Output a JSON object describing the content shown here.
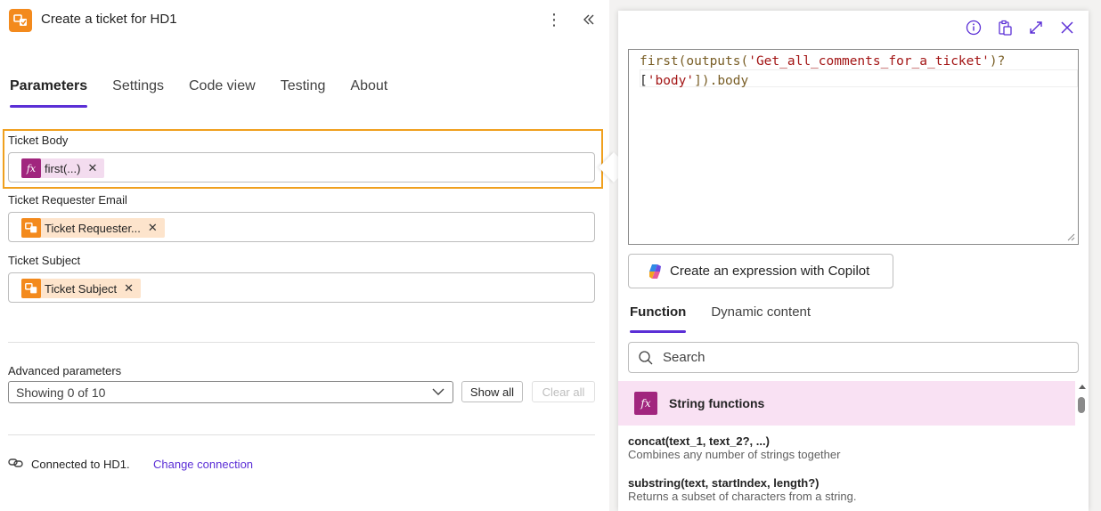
{
  "header": {
    "title": "Create a ticket for HD1",
    "more_label": "⋮"
  },
  "tabs": [
    {
      "label": "Parameters"
    },
    {
      "label": "Settings"
    },
    {
      "label": "Code view"
    },
    {
      "label": "Testing"
    },
    {
      "label": "About"
    }
  ],
  "fields": {
    "ticket_body": {
      "label": "Ticket Body",
      "token": "first(...)"
    },
    "ticket_requester_email": {
      "label": "Ticket Requester Email",
      "token": "Ticket Requester..."
    },
    "ticket_subject": {
      "label": "Ticket Subject",
      "token": "Ticket Subject"
    }
  },
  "token_remove": "✕",
  "advanced": {
    "label": "Advanced parameters",
    "selected": "Showing 0 of 10",
    "show_all": "Show all",
    "clear_all": "Clear all"
  },
  "connection": {
    "text": "Connected to HD1.",
    "change": "Change connection"
  },
  "expression": {
    "line1_fn": "first(outputs(",
    "line1_str": "'Get_all_comments_for_a_ticket'",
    "line1_end": ")?",
    "line2_open": "[",
    "line2_str": "'body'",
    "line2_end": "]).body"
  },
  "copilot_button": "Create an expression with Copilot",
  "right_tabs": [
    {
      "label": "Function"
    },
    {
      "label": "Dynamic content"
    }
  ],
  "search": {
    "placeholder": "Search"
  },
  "function_category": {
    "label": "String functions",
    "icon_text": "fx"
  },
  "functions": [
    {
      "name": "concat(text_1, text_2?, ...)",
      "desc": "Combines any number of strings together"
    },
    {
      "name": "substring(text, startIndex, length?)",
      "desc": "Returns a subset of characters from a string."
    }
  ],
  "icons": {
    "app": "connector-icon",
    "fx": "fx"
  },
  "colors": {
    "accent": "#5b2fd6",
    "highlight": "#f0a01e",
    "fx_token": "#a1267e",
    "connector": "#f38a1d"
  }
}
